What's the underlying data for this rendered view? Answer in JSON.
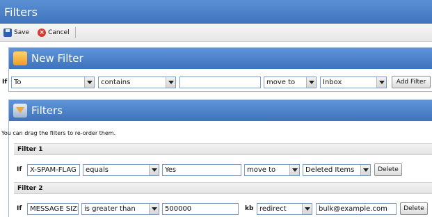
{
  "window": {
    "title": "Filters"
  },
  "toolbar": {
    "save_label": "Save",
    "cancel_label": "Cancel"
  },
  "new_filter": {
    "title": "New Filter",
    "if_label": "If",
    "field": "To",
    "condition": "contains",
    "value": "",
    "action": "move to",
    "target": "Inbox",
    "add_label": "Add Filter"
  },
  "filters": {
    "title": "Filters",
    "hint": "You can drag the filters to re-order them.",
    "items": [
      {
        "name": "Filter 1",
        "if_label": "If",
        "field": "X-SPAM-FLAG",
        "condition": "equals",
        "value": "Yes",
        "unit": "",
        "action": "move to",
        "target": "Deleted Items",
        "delete_label": "Delete"
      },
      {
        "name": "Filter 2",
        "if_label": "If",
        "field": "MESSAGE SIZE",
        "condition": "is greater than",
        "value": "500000",
        "unit": "kb",
        "action": "redirect",
        "target": "bulk@example.com",
        "delete_label": "Delete"
      }
    ]
  },
  "colors": {
    "header_blue": "#3f74bd",
    "panel_border": "#9db7d9",
    "input_border": "#7f9db9"
  }
}
